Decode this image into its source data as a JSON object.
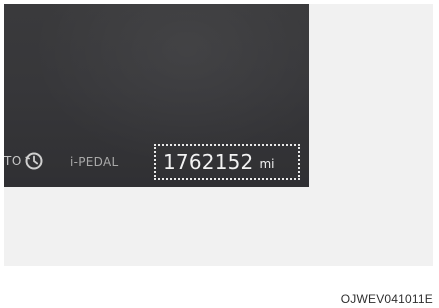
{
  "display": {
    "auto_label": "TO",
    "auto_icon": "auto-hold-icon",
    "ipedal_label": "i-PEDAL",
    "odometer_value": "1762152",
    "odometer_unit": "mi"
  },
  "figure_code": "OJWEV041011E",
  "colors": {
    "display_background": "#37373a",
    "figure_background": "#f1f1f1",
    "odometer_text": "#f2f2f2",
    "indicator_text": "#a9a9a9"
  }
}
